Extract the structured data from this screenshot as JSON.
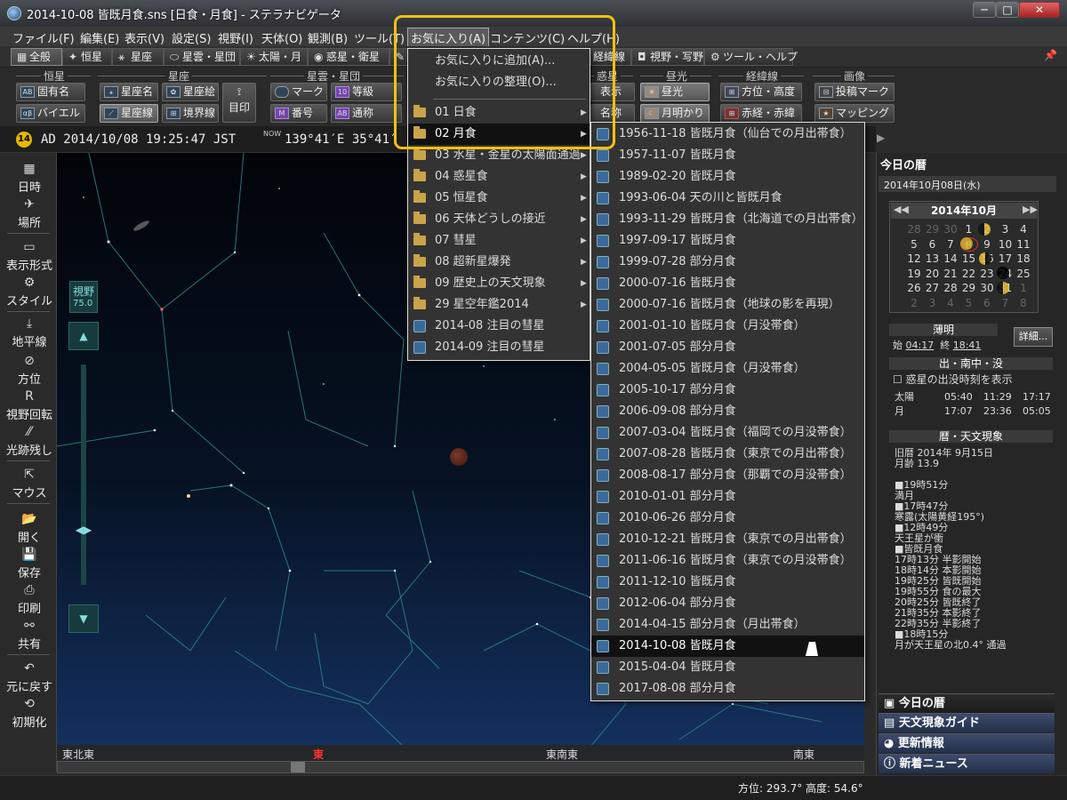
{
  "window": {
    "title": "2014-10-08 皆既月食.sns [日食・月食] - ステラナビゲータ",
    "minimize": "─",
    "maximize": "□",
    "close": "✕"
  },
  "menubar": [
    "ファイル(F)",
    "編集(E)",
    "表示(V)",
    "設定(S)",
    "視野(I)",
    "天体(O)",
    "観測(B)",
    "ツール(T)",
    "お気に入り(A)",
    "コンテンツ(C)",
    "ヘルプ(H)"
  ],
  "tabs": [
    "全般",
    "恒星",
    "星座",
    "星雲・星団",
    "太陽・月",
    "惑星・衛星",
    "経緯線",
    "視野・写野",
    "ツール・ヘルプ"
  ],
  "ribbon": {
    "groups": [
      "恒星",
      "星座",
      "星雲・星団",
      "惑星",
      "昼光",
      "経緯線",
      "画像"
    ],
    "buttons": [
      "固有名",
      "バイエル",
      "星座名",
      "星座絵",
      "星座線",
      "境界線",
      "目印",
      "マーク",
      "番号",
      "等級",
      "通称",
      "表示",
      "名称",
      "昼光",
      "月明かり",
      "方位・高度",
      "赤経・赤緯",
      "投稿マーク",
      "マッピング"
    ]
  },
  "status": {
    "badge": "14",
    "datetime": "AD 2014/10/08 19:25:47 JST",
    "now_label": "NOW",
    "coords": "139°41′E 35°41′"
  },
  "leftbar": [
    "日時",
    "場所",
    "表示形式",
    "スタイル",
    "地平線",
    "方位",
    "視野回転",
    "光跡残し",
    "マウス",
    "開く",
    "保存",
    "印刷",
    "共有",
    "元に戻す",
    "初期化"
  ],
  "fov": {
    "label": "視野",
    "value": "75.0"
  },
  "horizon_labels": [
    "東北東",
    "東",
    "東南東",
    "南東"
  ],
  "position_readout": "方位: 293.7° 高度: 54.6°",
  "favorites_menu": {
    "top_items": [
      "お気に入りに追加(A)...",
      "お気に入りの整理(O)..."
    ],
    "folders": [
      "01 日食",
      "02 月食",
      "03 水星・金星の太陽面通過",
      "04 惑星食",
      "05 恒星食",
      "06 天体どうしの接近",
      "07 彗星",
      "08 超新星爆発",
      "09 歴史上の天文現象",
      "29 星空年鑑2014"
    ],
    "links": [
      "2014-08 注目の彗星",
      "2014-09 注目の彗星"
    ],
    "highlighted": "02 月食"
  },
  "eclipse_menu": {
    "items": [
      "1956-11-18 皆既月食（仙台での月出帯食）",
      "1957-11-07 皆既月食",
      "1989-02-20 皆既月食",
      "1993-06-04 天の川と皆既月食",
      "1993-11-29 皆既月食（北海道での月出帯食）",
      "1997-09-17 皆既月食",
      "1999-07-28 部分月食",
      "2000-07-16 皆既月食",
      "2000-07-16 皆既月食（地球の影を再現）",
      "2001-01-10 皆既月食（月没帯食）",
      "2001-07-05 部分月食",
      "2004-05-05 皆既月食（月没帯食）",
      "2005-10-17 部分月食",
      "2006-09-08 部分月食",
      "2007-03-04 皆既月食（福岡での月没帯食）",
      "2007-08-28 皆既月食（東京での月出帯食）",
      "2008-08-17 部分月食（那覇での月没帯食）",
      "2010-01-01 部分月食",
      "2010-06-26 部分月食",
      "2010-12-21 皆既月食（東京での月出帯食）",
      "2011-06-16 皆既月食（東京での月没帯食）",
      "2011-12-10 皆既月食",
      "2012-06-04 部分月食",
      "2014-04-15 部分月食（月出帯食）",
      "2014-10-08 皆既月食",
      "2015-04-04 皆既月食",
      "2017-08-08 部分月食"
    ],
    "highlighted": "2014-10-08 皆既月食"
  },
  "right_panel": {
    "title": "今日の暦",
    "date": "2014年10月08日(水)",
    "calendar": {
      "month": "2014年10月",
      "rows": [
        [
          "28",
          "29",
          "30",
          "1",
          "2",
          "3",
          "4"
        ],
        [
          "5",
          "6",
          "7",
          "8",
          "9",
          "10",
          "11"
        ],
        [
          "12",
          "13",
          "14",
          "15",
          "16",
          "17",
          "18"
        ],
        [
          "19",
          "20",
          "21",
          "22",
          "23",
          "24",
          "25"
        ],
        [
          "26",
          "27",
          "28",
          "29",
          "30",
          "31",
          "1"
        ],
        [
          "2",
          "3",
          "4",
          "5",
          "6",
          "7",
          "8"
        ]
      ]
    },
    "twilight": {
      "label": "薄明",
      "start_label": "始",
      "start": "04:17",
      "end_label": "終",
      "end": "18:41"
    },
    "detail_button": "詳細...",
    "rise_set": {
      "title": "出・南中・没",
      "checkbox": "惑星の出没時刻を表示",
      "sun": [
        "太陽",
        "05:40",
        "11:29",
        "17:17"
      ],
      "moon": [
        "月",
        "17:07",
        "23:36",
        "05:05"
      ]
    },
    "events": {
      "title": "暦・天文現象",
      "lines": [
        "旧暦 2014年 9月15日",
        "月齢 13.9",
        "",
        "■19時51分",
        "  満月",
        "■17時47分",
        "  寒露(太陽黄経195°)",
        "■12時49分",
        "  天王星が衝",
        "■皆既月食",
        "  17時13分 半影開始",
        "  18時14分 本影開始",
        "  19時25分 皆既開始",
        "  19時55分 食の最大",
        "  20時25分 皆既終了",
        "  21時35分 本影終了",
        "  22時35分 半影終了",
        "■18時15分",
        "  月が天王星の北0.4° 通過"
      ]
    },
    "nav": [
      "今日の暦",
      "天文現象ガイド",
      "更新情報",
      "新着ニュース"
    ]
  }
}
